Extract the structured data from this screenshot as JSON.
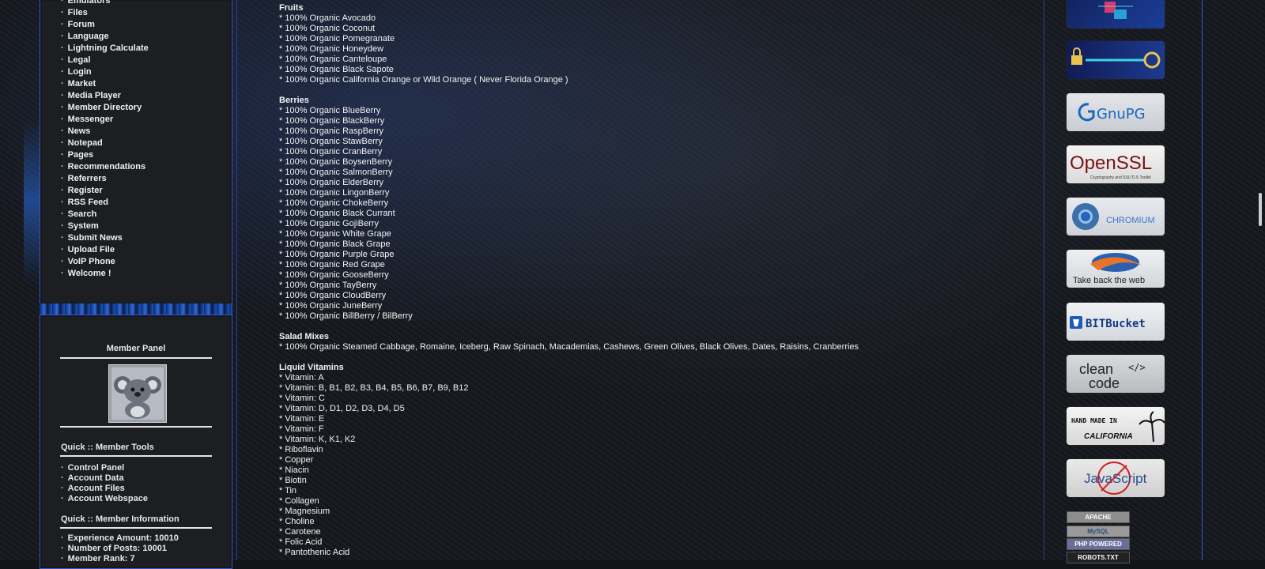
{
  "left_modules": [
    "Emulators",
    "Files",
    "Forum",
    "Language",
    "Lightning Calculate",
    "Legal",
    "Login",
    "Market",
    "Media Player",
    "Member Directory",
    "Messenger",
    "News",
    "Notepad",
    "Pages",
    "Recommendations",
    "Referrers",
    "Register",
    "RSS Feed",
    "Search",
    "System",
    "Submit News",
    "Upload File",
    "VoIP Phone",
    "Welcome !"
  ],
  "member_panel": {
    "title": "Member Panel",
    "tools_title": "Quick :: Member Tools",
    "tools": [
      "Control Panel",
      "Account Data",
      "Account Files",
      "Account Webspace"
    ],
    "info_title": "Quick :: Member Information",
    "info": [
      "Experience Amount: 10010",
      "Number of Posts: 10001",
      "Member Rank: 7"
    ]
  },
  "content": {
    "fruits_title": "Fruits",
    "fruits": [
      "* 100% Organic Avocado",
      "* 100% Organic Coconut",
      "* 100% Organic Pomegranate",
      "* 100% Organic Honeydew",
      "* 100% Organic Canteloupe",
      "* 100% Organic Black Sapote",
      "* 100% Organic California Orange or Wild Orange ( Never Florida Orange )"
    ],
    "berries_title": "Berries",
    "berries": [
      "* 100% Organic BlueBerry",
      "* 100% Organic BlackBerry",
      "* 100% Organic RaspBerry",
      "* 100% Organic StawBerry",
      "* 100% Organic CranBerry",
      "* 100% Organic BoysenBerry",
      "* 100% Organic SalmonBerry",
      "* 100% Organic ElderBerry",
      "* 100% Organic LingonBerry",
      "* 100% Organic ChokeBerry",
      "* 100% Organic Black Currant",
      "* 100% Organic GojiBerry",
      "* 100% Organic White Grape",
      "* 100% Organic Black Grape",
      "* 100% Organic Purple Grape",
      "* 100% Organic Red Grape",
      "* 100% Organic GooseBerry",
      "* 100% Organic TayBerry",
      "* 100% Organic CloudBerry",
      "* 100% Organic JuneBerry",
      "* 100% Organic BillBerry / BilBerry"
    ],
    "salad_title": "Salad Mixes",
    "salad": [
      "* 100% Organic Steamed Cabbage, Romaine, Iceberg, Raw Spinach, Macademias, Cashews, Green Olives, Black Olives, Dates, Raisins, Cranberries"
    ],
    "vitamins_title": "Liquid Vitamins",
    "vitamins": [
      "* Vitamin: A",
      "* Vitamin: B, B1, B2, B3, B4, B5, B6, B7, B9, B12",
      "* Vitamin: C",
      "* Vitamin: D, D1, D2, D3, D4, D5",
      "* Vitamin: E",
      "* Vitamin: F",
      "* Vitamin: K, K1, K2",
      "* Riboflavin",
      "* Copper",
      "* Niacin",
      "* Biotin",
      "* Tin",
      "* Collagen",
      "* Magnesium",
      "* Choline",
      "* Carotene",
      "* Folic Acid",
      "* Pantothenic Acid"
    ]
  },
  "badges": {
    "gnupg": "GnuPG",
    "openssl": "OpenSSL",
    "openssl_sub": "Cryptography and SSL/TLS Toolkit",
    "chromium": "CHROMIUM",
    "firefox": "Take back the web",
    "bitbucket": "BITBucket",
    "cleancode_1": "clean",
    "cleancode_2": "code",
    "handmade_1": "HAND MADE IN",
    "handmade_2": "CALIFORNIA",
    "javascript": "JavaScript",
    "apache": "APACHE",
    "mysql": "MySQL",
    "php": "PHP POWERED",
    "robots": "ROBOTS.TXT"
  },
  "colors": {
    "background": "#121418",
    "panel_border": "#3a55c8",
    "text": "#f2f2f2"
  }
}
